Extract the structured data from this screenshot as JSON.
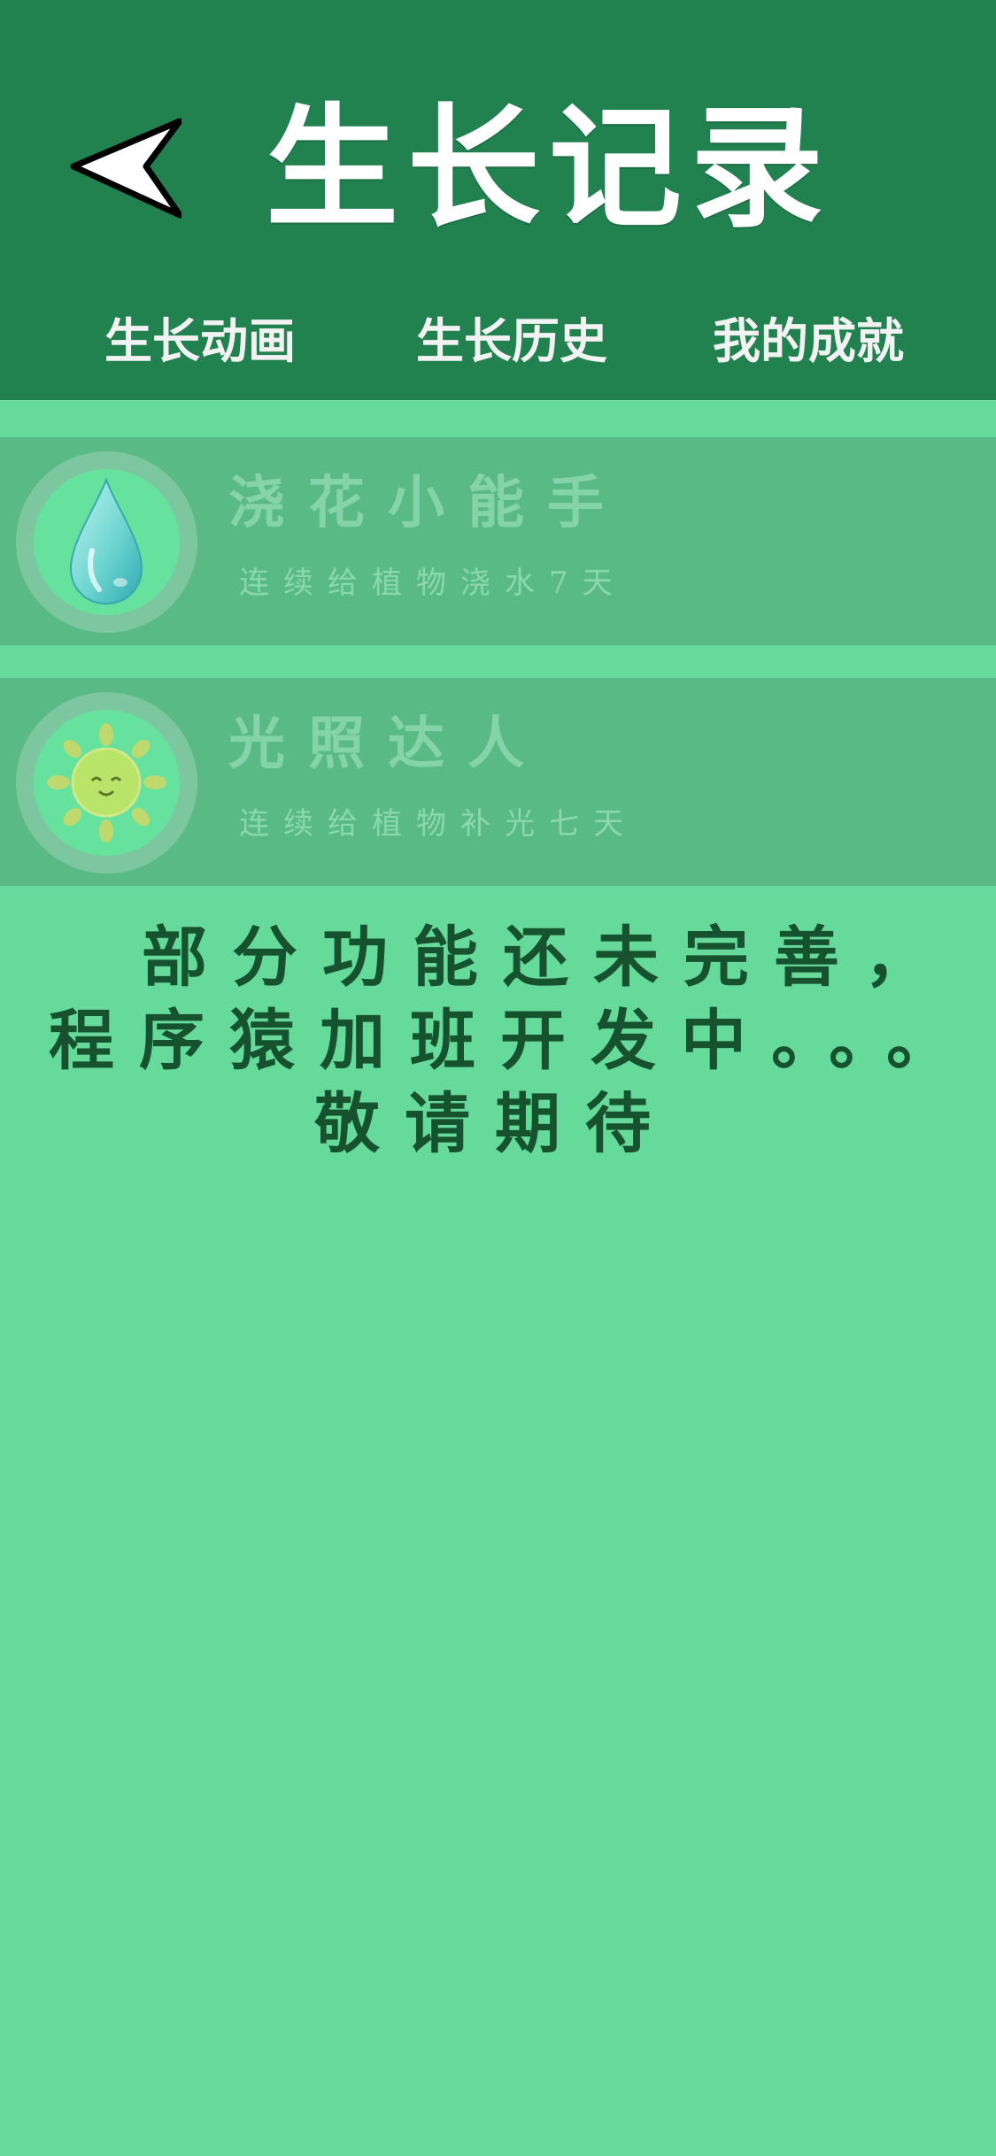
{
  "header": {
    "title": "生长记录",
    "back_icon": "back-arrow-icon",
    "background": "#218250"
  },
  "tabs": [
    {
      "label": "生长动画"
    },
    {
      "label": "生长历史"
    },
    {
      "label": "我的成就"
    }
  ],
  "achievements": [
    {
      "title": "浇花小能手",
      "subtitle": "连续给植物浇水7天",
      "icon": "water-drop-icon"
    },
    {
      "title": "光照达人",
      "subtitle": "连续给植物补光七天",
      "icon": "sun-icon"
    }
  ],
  "notice": {
    "line1": "部分功能还未完善，",
    "line2": "程序猿加班开发中。。。",
    "line3": "敬请期待"
  },
  "colors": {
    "page_background": "#66DA9A",
    "card_background": "#59BA85",
    "notice_text": "#17522F"
  }
}
